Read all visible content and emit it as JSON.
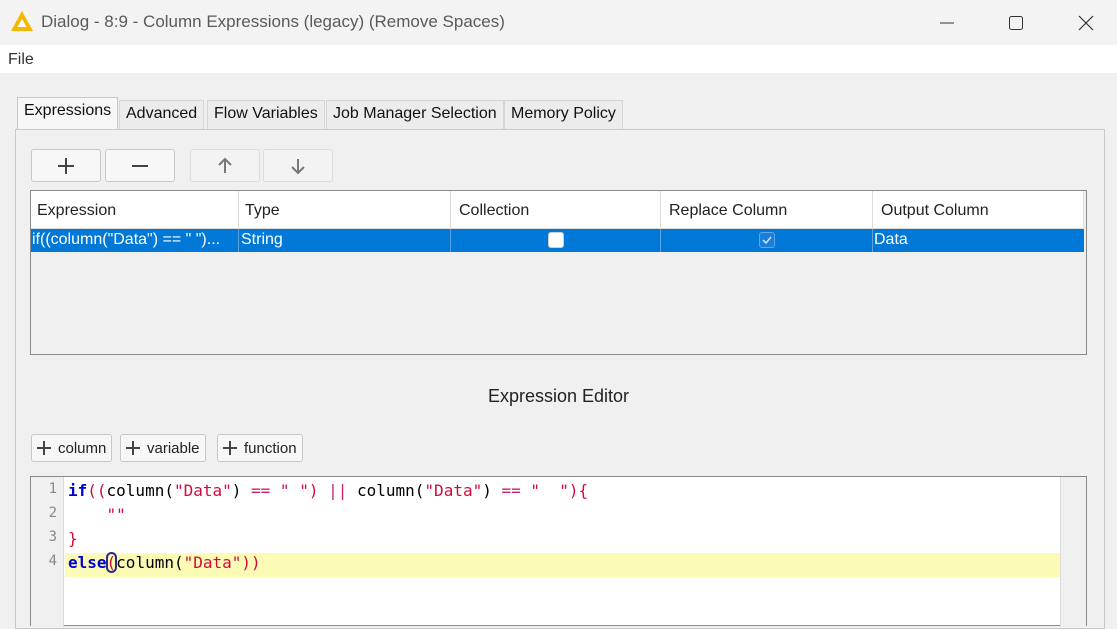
{
  "window": {
    "title": "Dialog - 8:9 - Column Expressions (legacy) (Remove Spaces)",
    "controls": {
      "minimize": "minimize-icon",
      "maximize": "maximize-icon",
      "close": "close-icon"
    }
  },
  "menu": {
    "file": "File"
  },
  "tabs": [
    {
      "label": "Expressions",
      "active": true
    },
    {
      "label": "Advanced"
    },
    {
      "label": "Flow Variables"
    },
    {
      "label": "Job Manager Selection"
    },
    {
      "label": "Memory Policy"
    }
  ],
  "toolbar": {
    "add": "plus-icon",
    "remove": "minus-icon",
    "move_up": "arrow-up-icon",
    "move_down": "arrow-down-icon"
  },
  "table": {
    "columns": [
      "Expression",
      "Type",
      "Collection",
      "Replace Column",
      "Output Column"
    ],
    "rows": [
      {
        "expression": "if((column(\"Data\") == \" \")...",
        "type": "String",
        "collection": false,
        "replace_column": true,
        "output_column": "Data",
        "selected": true
      }
    ]
  },
  "editor": {
    "title": "Expression Editor",
    "buttons": {
      "column": "column",
      "variable": "variable",
      "function": "function"
    },
    "line_numbers": [
      "1",
      "2",
      "3",
      "4"
    ],
    "code": {
      "l1_kw": "if",
      "l1_a": "((",
      "l1_fn1": "column(",
      "l1_s1": "\"Data\"",
      "l1_b": ") ",
      "l1_op1": "==",
      "l1_s2": " \" \"",
      "l1_c": ") ",
      "l1_or": "||",
      "l1_fn2": " column(",
      "l1_s3": "\"Data\"",
      "l1_d": ") ",
      "l1_op2": "==",
      "l1_s4": " \"  \"",
      "l1_e": "){",
      "l2": "    \"\"",
      "l3": "}",
      "l4_kw": "else",
      "l4_p": "(",
      "l4_fn": "column(",
      "l4_s": "\"Data\"",
      "l4_end": "))"
    }
  },
  "colors": {
    "selection": "#0078d7",
    "keyword": "#0000d8",
    "string": "#d20a3c",
    "current_line": "#fbfbb5",
    "app_icon": "#f5b800"
  }
}
